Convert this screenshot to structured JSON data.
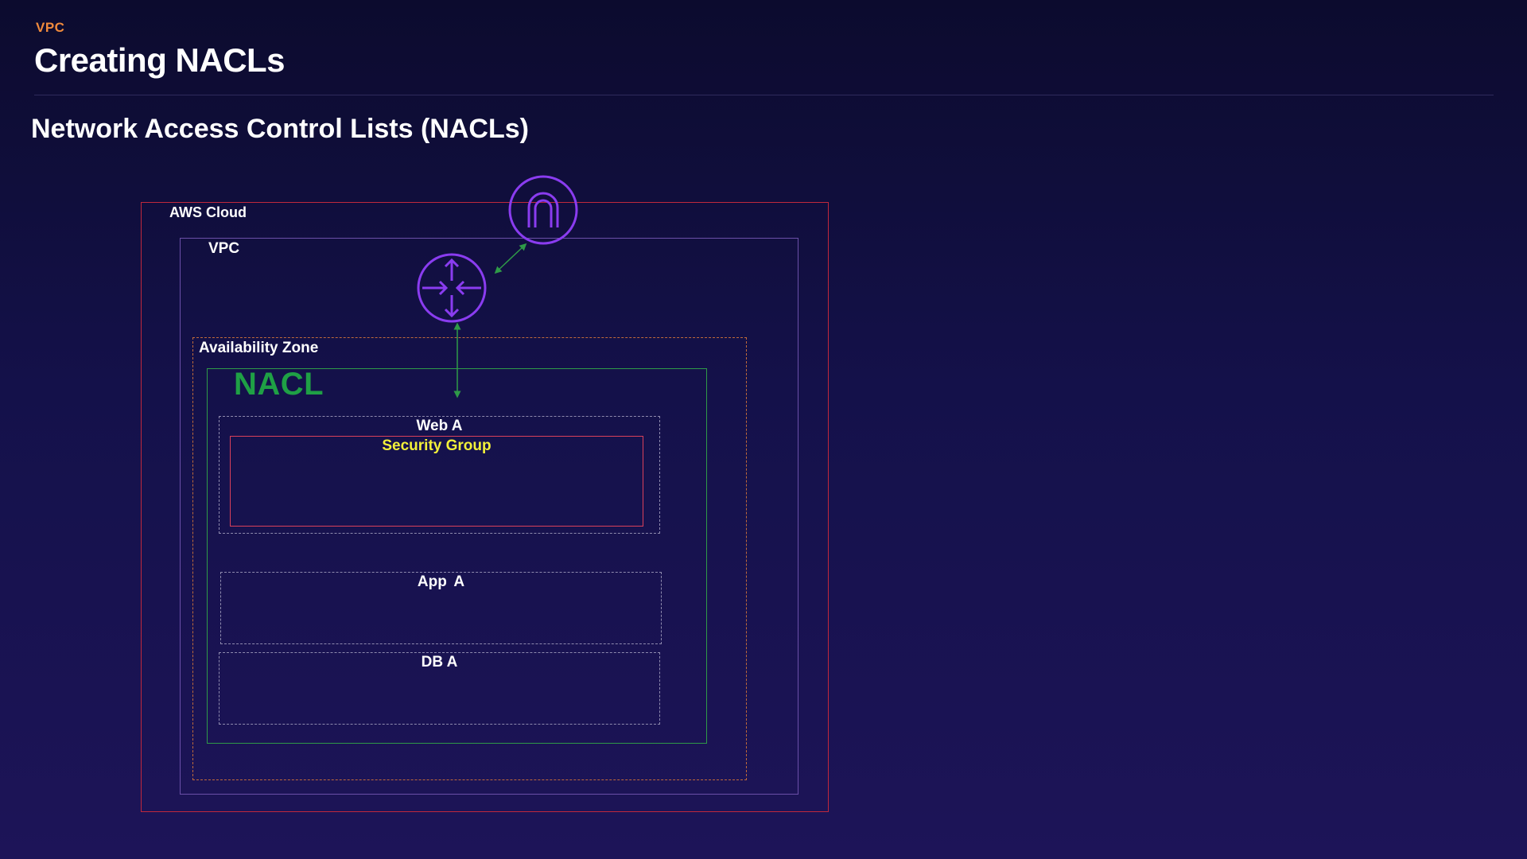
{
  "header": {
    "section_tag": "VPC",
    "title": "Creating NACLs",
    "subtitle": "Network Access Control Lists (NACLs)"
  },
  "diagram": {
    "aws_cloud_label": "AWS Cloud",
    "vpc_label": "VPC",
    "availability_zone_label": "Availability Zone",
    "nacl_label": "NACL",
    "web_subnet_label": "Web A",
    "security_group_label": "Security Group",
    "app_subnet_label": "App  A",
    "db_subnet_label": "DB A",
    "icons": {
      "internet_gateway": "internet-gateway-icon",
      "router": "router-icon"
    }
  },
  "colors": {
    "section_tag": "#f08a3c",
    "aws_cloud_border": "#c0283c",
    "vpc_border": "#6b4fa8",
    "availability_zone_border": "#c06a3a",
    "nacl": "#1fa045",
    "security_group_border": "#d9405a",
    "security_group_label": "#f2f03a",
    "icon_purple": "#8a3cf0"
  }
}
